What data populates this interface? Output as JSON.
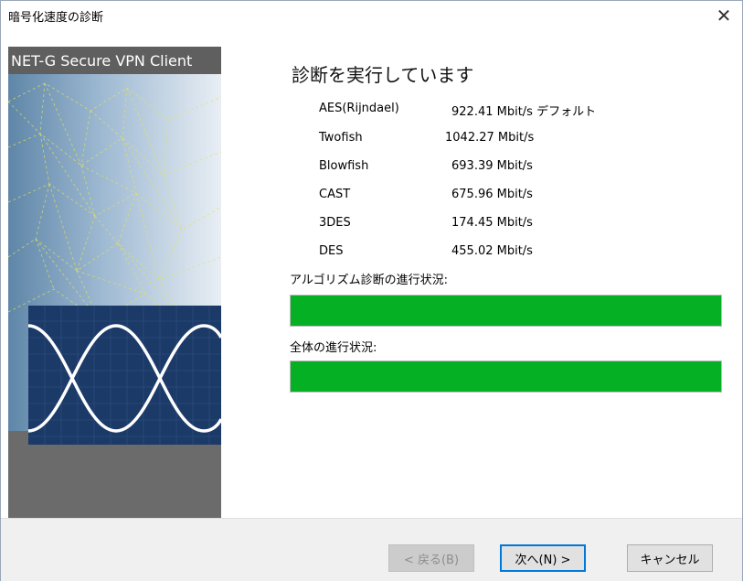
{
  "window": {
    "title": "暗号化速度の診断",
    "close_icon": "close-icon"
  },
  "sidebar": {
    "product_name": "NET-G Secure VPN Client"
  },
  "main": {
    "heading": "診断を実行しています",
    "results": [
      {
        "algorithm": "AES(Rijndael)",
        "speed": "922.41 Mbit/s デフォルト"
      },
      {
        "algorithm": "Twofish",
        "speed": "1042.27 Mbit/s"
      },
      {
        "algorithm": "Blowfish",
        "speed": "693.39 Mbit/s"
      },
      {
        "algorithm": "CAST",
        "speed": "675.96 Mbit/s"
      },
      {
        "algorithm": "3DES",
        "speed": "174.45 Mbit/s"
      },
      {
        "algorithm": "DES",
        "speed": "455.02 Mbit/s"
      }
    ],
    "algorithm_progress_label": "アルゴリズム診断の進行状況:",
    "algorithm_progress": 1.0,
    "overall_progress_label": "全体の進行状況:",
    "overall_progress": 1.0
  },
  "footer": {
    "back_label": "< 戻る(B)",
    "next_label": "次へ(N) >",
    "cancel_label": "キャンセル"
  },
  "colors": {
    "progress_fill": "#06b025",
    "side_title_bg": "#5f5f5f",
    "default_button_border": "#0078d7"
  }
}
